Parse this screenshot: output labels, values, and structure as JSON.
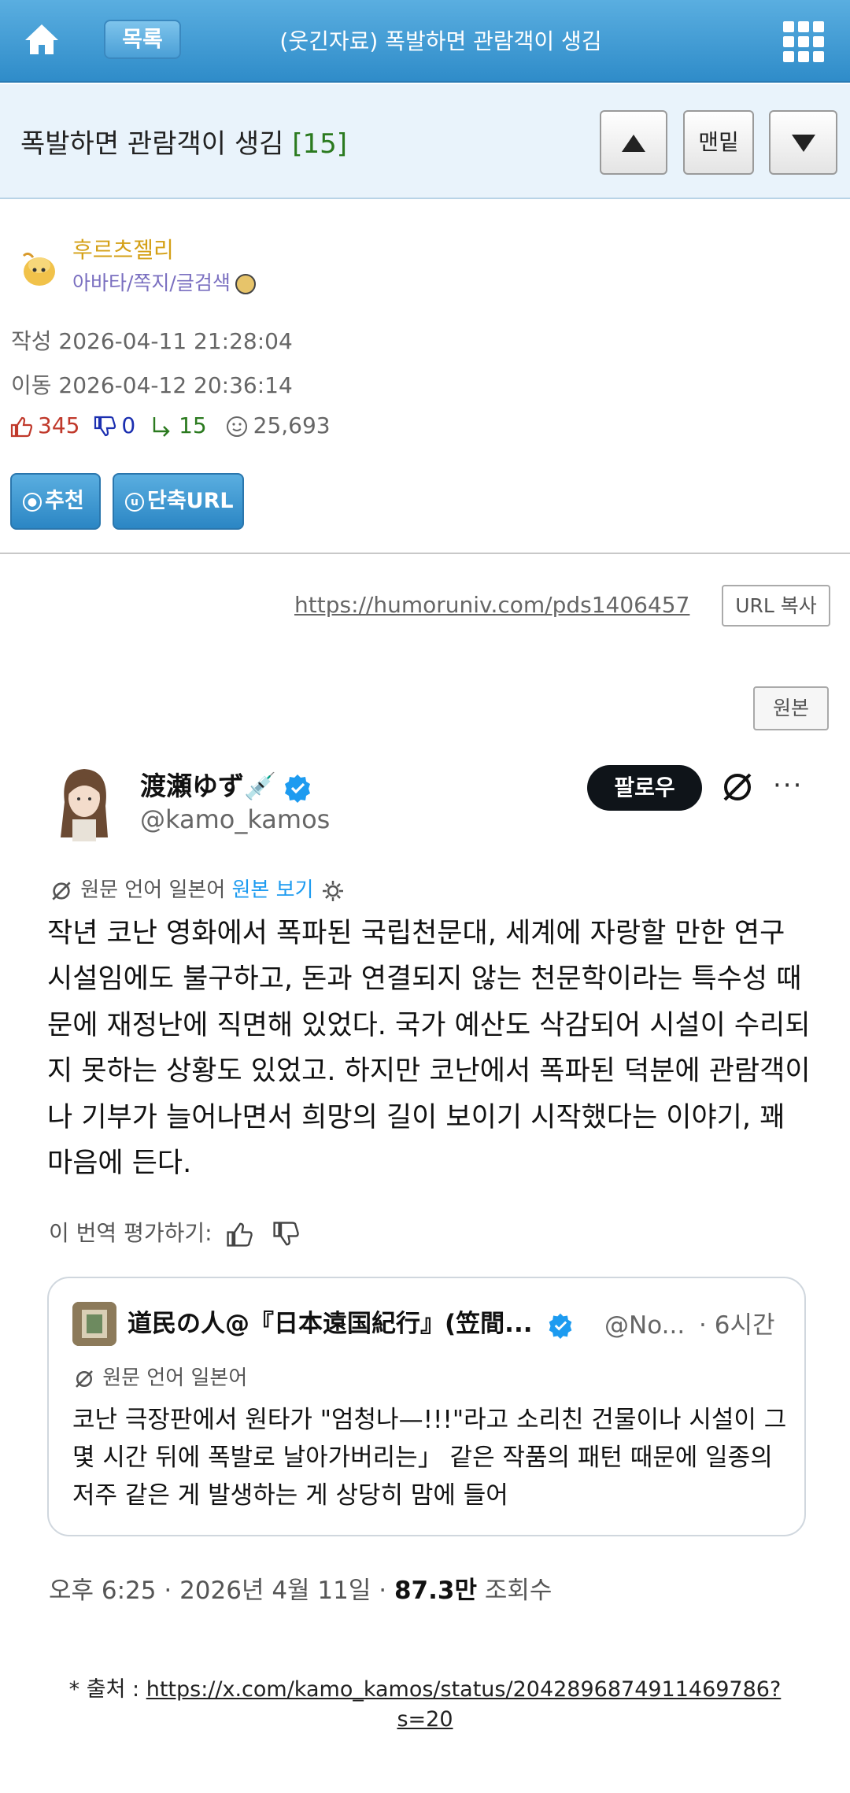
{
  "topbar": {
    "list_label": "목록",
    "title": "(웃긴자료) 폭발하면 관람객이 생김"
  },
  "post": {
    "title": "폭발하면 관람객이 생김",
    "comment_count": "[15]",
    "bottom_label": "맨밑"
  },
  "author": {
    "name": "후르츠젤리",
    "links": "아바타/쪽지/글검색"
  },
  "meta": {
    "created": "작성 2026-04-11 21:28:04",
    "moved": "이동 2026-04-12 20:36:14"
  },
  "stats": {
    "likes": "345",
    "dislikes": "0",
    "comments": "15",
    "views": "25,693"
  },
  "buttons": {
    "recommend": "추천",
    "short_url": "단축URL"
  },
  "url": {
    "text": "https://humoruniv.com/pds1406457",
    "copy_label": "URL 복사",
    "original_label": "원본"
  },
  "tweet": {
    "name": "渡瀬ゆず💉",
    "handle": "@kamo_kamos",
    "follow_label": "팔로우",
    "translated_from": "원문 언어 일본어",
    "view_original": "원본 보기",
    "body": "작년 코난 영화에서 폭파된 국립천문대, 세계에 자랑할 만한 연구 시설임에도 불구하고, 돈과 연결되지 않는 천문학이라는 특수성 때문에 재정난에 직면해 있었다. 국가 예산도 삭감되어 시설이 수리되지 못하는 상황도 있었고. 하지만 코난에서 폭파된 덕분에 관람객이나 기부가 늘어나면서 희망의 길이 보이기 시작했다는 이야기, 꽤 마음에 든다.",
    "rate_label": "이 번역 평가하기:",
    "time": "오후 6:25 · 2026년 4월 11일 · ",
    "views_count": "87.3만",
    "views_label": "조회수"
  },
  "quote": {
    "name": "道民の人@『日本遠国紀行』(笠間...",
    "handle": "@No...",
    "time": "· 6시간",
    "translated_from": "원문 언어 일본어",
    "body": "코난 극장판에서 원타가 \"엄청나—!!!\"라고 소리친 건물이나 시설이 그 몇 시간 뒤에 폭발로 날아가버리는」 같은 작품의 패턴 때문에 일종의 저주 같은 게 발생하는 게 상당히 맘에 들어"
  },
  "source": {
    "prefix": "* 출처 : ",
    "url": "https://x.com/kamo_kamos/status/2042896874911469786?s=20"
  },
  "colors": {
    "topbar": "#3a96d2",
    "title_bg": "#e9f3fb",
    "author": "#d4a017",
    "like": "#c0392b",
    "dislike": "#1b2fb0",
    "reply": "#2b7a1f",
    "verified": "#1d9bf0"
  }
}
